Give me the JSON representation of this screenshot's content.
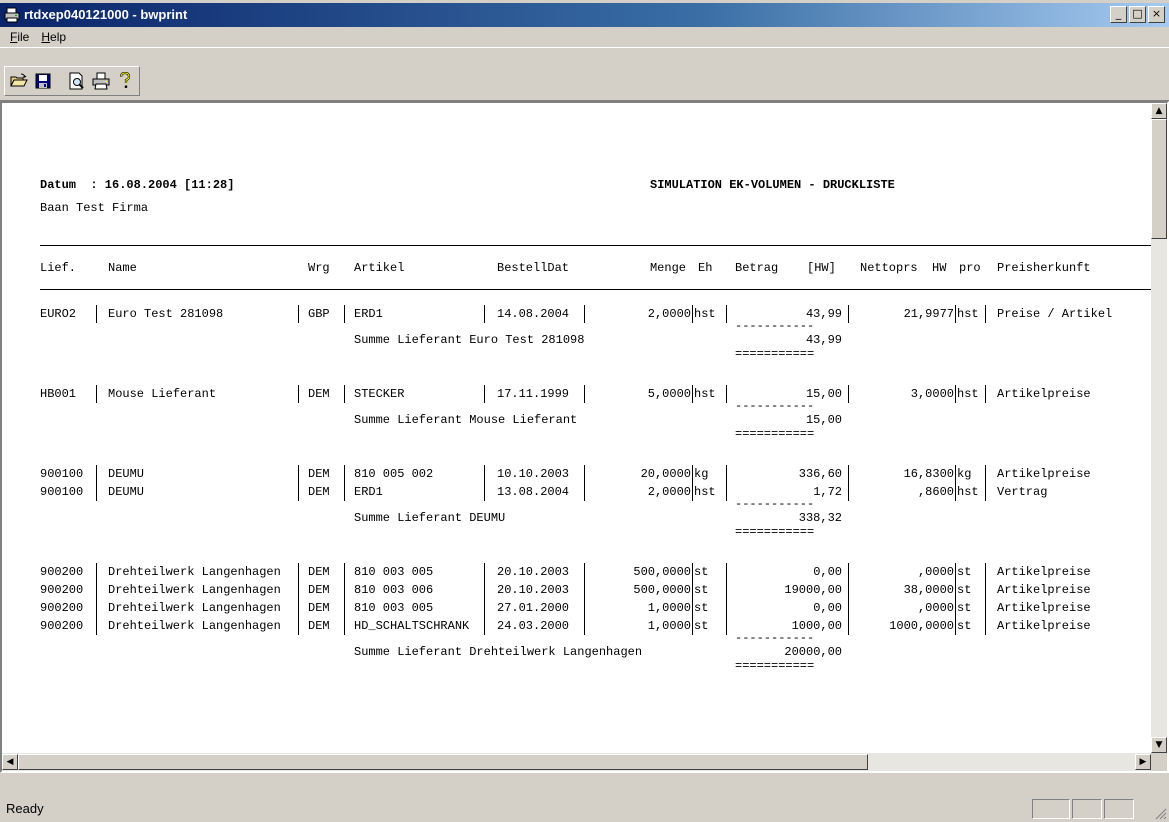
{
  "window": {
    "title": "rtdxep040121000 - bwprint",
    "minimize": "_",
    "maximize": "□",
    "close": "×"
  },
  "menu": [
    {
      "label": "File",
      "u": "F",
      "rest": "ile"
    },
    {
      "label": "Help",
      "u": "H",
      "rest": "elp"
    }
  ],
  "toolbar": {
    "buttons": [
      "open-icon",
      "save-icon",
      "print-preview-icon",
      "print-icon",
      "help-icon"
    ]
  },
  "report": {
    "datum": "Datum  : 16.08.2004 [11:28]",
    "firma": "Baan Test Firma",
    "title": "SIMULATION EK-VOLUMEN - DRUCKLISTE",
    "headers": {
      "lief": "Lief.",
      "name": "Name",
      "wrg": "Wrg",
      "artikel": "Artikel",
      "bestelldat": "BestellDat",
      "menge": "Menge",
      "eh": "Eh",
      "betrag": "Betrag",
      "hw": "[HW]",
      "nettoprs": "Nettoprs  HW",
      "pro": "pro",
      "preisherkunft": "Preisherkunft"
    },
    "groups": [
      {
        "rows": [
          {
            "lief": "EURO2",
            "name": "Euro Test 281098",
            "wrg": "GBP",
            "artikel": "ERD1",
            "datum": "14.08.2004",
            "menge": "2,0000",
            "eh": "hst",
            "betrag": "43,99",
            "netto": "21,9977",
            "pro": "hst",
            "herkunft": "Preise / Artikel"
          }
        ],
        "summe_label": "Summe Lieferant Euro Test 281098",
        "summe": "43,99"
      },
      {
        "rows": [
          {
            "lief": "HB001",
            "name": "Mouse Lieferant",
            "wrg": "DEM",
            "artikel": "STECKER",
            "datum": "17.11.1999",
            "menge": "5,0000",
            "eh": "hst",
            "betrag": "15,00",
            "netto": "3,0000",
            "pro": "hst",
            "herkunft": "Artikelpreise"
          }
        ],
        "summe_label": "Summe Lieferant Mouse Lieferant",
        "summe": "15,00"
      },
      {
        "rows": [
          {
            "lief": "900100",
            "name": "DEUMU",
            "wrg": "DEM",
            "artikel": "810 005 002",
            "datum": "10.10.2003",
            "menge": "20,0000",
            "eh": "kg",
            "betrag": "336,60",
            "netto": "16,8300",
            "pro": "kg",
            "herkunft": "Artikelpreise"
          },
          {
            "lief": "900100",
            "name": "DEUMU",
            "wrg": "DEM",
            "artikel": "ERD1",
            "datum": "13.08.2004",
            "menge": "2,0000",
            "eh": "hst",
            "betrag": "1,72",
            "netto": ",8600",
            "pro": "hst",
            "herkunft": "Vertrag"
          }
        ],
        "summe_label": "Summe Lieferant DEUMU",
        "summe": "338,32"
      },
      {
        "rows": [
          {
            "lief": "900200",
            "name": "Drehteilwerk Langenhagen",
            "wrg": "DEM",
            "artikel": "810 003 005",
            "datum": "20.10.2003",
            "menge": "500,0000",
            "eh": "st",
            "betrag": "0,00",
            "netto": ",0000",
            "pro": "st",
            "herkunft": "Artikelpreise"
          },
          {
            "lief": "900200",
            "name": "Drehteilwerk Langenhagen",
            "wrg": "DEM",
            "artikel": "810 003 006",
            "datum": "20.10.2003",
            "menge": "500,0000",
            "eh": "st",
            "betrag": "19000,00",
            "netto": "38,0000",
            "pro": "st",
            "herkunft": "Artikelpreise"
          },
          {
            "lief": "900200",
            "name": "Drehteilwerk Langenhagen",
            "wrg": "DEM",
            "artikel": "810 003 005",
            "datum": "27.01.2000",
            "menge": "1,0000",
            "eh": "st",
            "betrag": "0,00",
            "netto": ",0000",
            "pro": "st",
            "herkunft": "Artikelpreise"
          },
          {
            "lief": "900200",
            "name": "Drehteilwerk Langenhagen",
            "wrg": "DEM",
            "artikel": "HD_SCHALTSCHRANK",
            "datum": "24.03.2000",
            "menge": "1,0000",
            "eh": "st",
            "betrag": "1000,00",
            "netto": "1000,0000",
            "pro": "st",
            "herkunft": "Artikelpreise"
          }
        ],
        "summe_label": "Summe Lieferant Drehteilwerk Langenhagen",
        "summe": "20000,00"
      }
    ],
    "dash_line": "-----------",
    "eq_line": "==========="
  },
  "status": {
    "text": "Ready"
  }
}
